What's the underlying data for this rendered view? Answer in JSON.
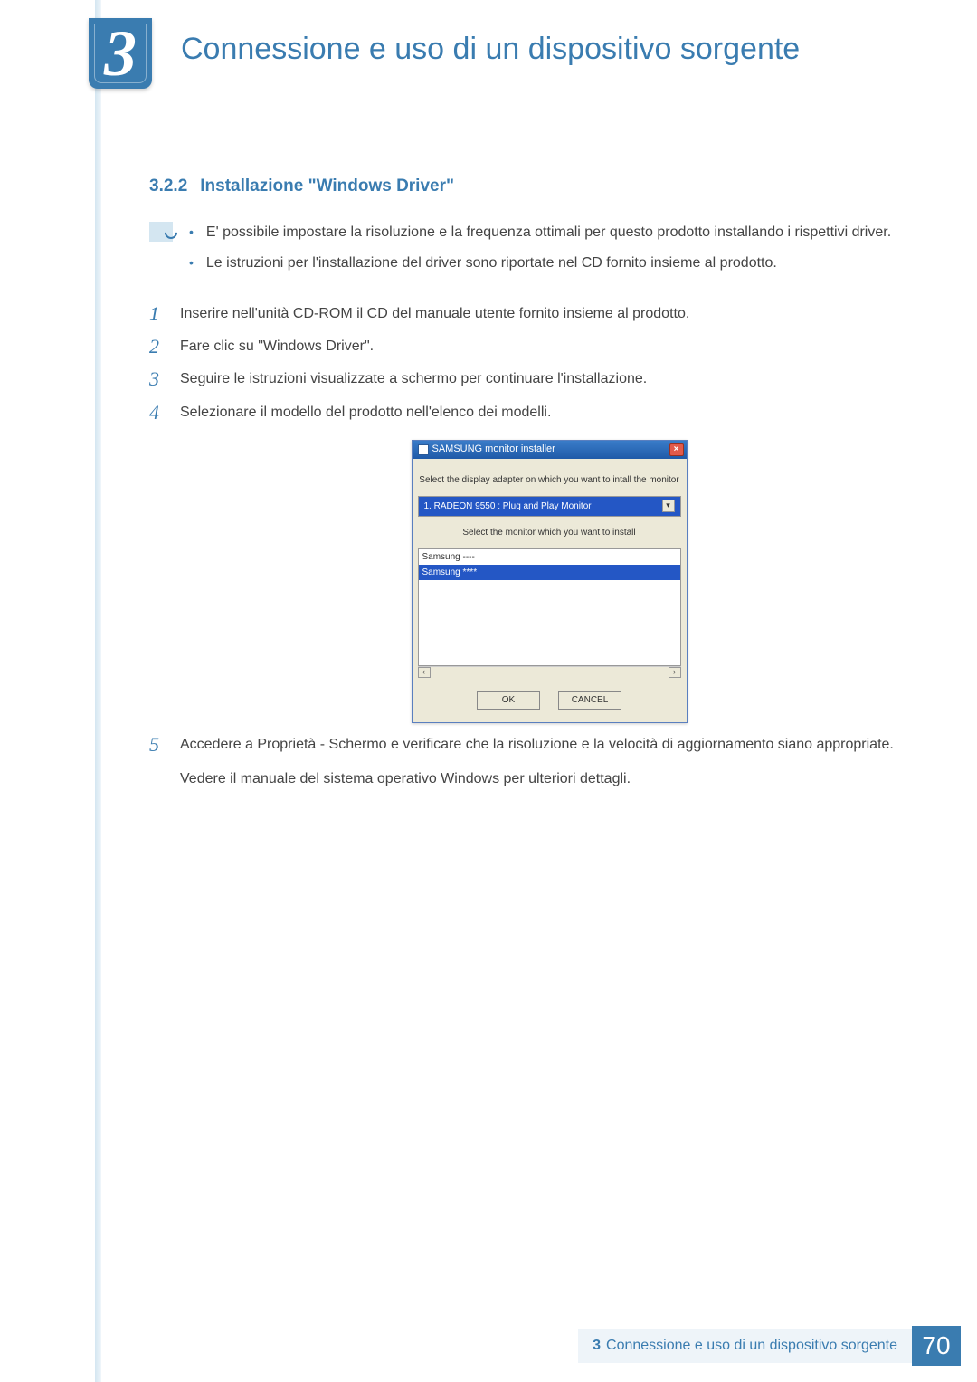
{
  "chapter_badge": "3",
  "page_title": "Connessione e uso di un dispositivo sorgente",
  "section": {
    "num": "3.2.2",
    "title": "Installazione \"Windows Driver\""
  },
  "notes": [
    "E' possibile impostare la risoluzione e la frequenza ottimali per questo prodotto installando i rispettivi driver.",
    "Le istruzioni per l'installazione del driver sono riportate nel CD fornito insieme al prodotto."
  ],
  "steps": [
    {
      "n": "1",
      "text": "Inserire nell'unità CD-ROM il CD del manuale utente fornito insieme al prodotto."
    },
    {
      "n": "2",
      "text": "Fare clic su \"Windows Driver\"."
    },
    {
      "n": "3",
      "text": "Seguire le istruzioni visualizzate a schermo per continuare l'installazione."
    },
    {
      "n": "4",
      "text": "Selezionare il modello del prodotto nell'elenco dei modelli."
    },
    {
      "n": "5",
      "text": "Accedere a Proprietà - Schermo e verificare che la risoluzione e la velocità di aggiornamento siano appropriate.",
      "extra": "Vedere il manuale del sistema operativo Windows per ulteriori dettagli."
    }
  ],
  "installer": {
    "title": "SAMSUNG monitor installer",
    "line1": "Select the display adapter on which you want to intall the monitor",
    "adapter": "1. RADEON 9550 : Plug and Play Monitor",
    "line2": "Select the monitor which you want to install",
    "rows": [
      "Samsung ----",
      "Samsung ****"
    ],
    "ok": "OK",
    "cancel": "CANCEL"
  },
  "footer": {
    "chapter": "3",
    "title": "Connessione e uso di un dispositivo sorgente",
    "page": "70"
  }
}
